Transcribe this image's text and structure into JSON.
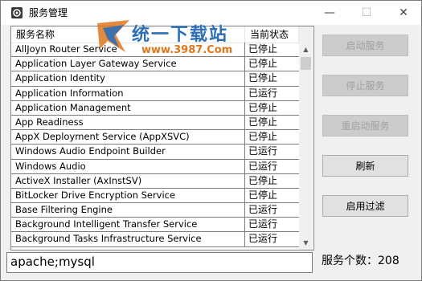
{
  "window": {
    "title": "服务管理",
    "minimize_glyph": "—",
    "maximize_glyph": "☐",
    "close_glyph": "✕"
  },
  "watermark": {
    "title": "统一下载站",
    "url": "www.3987.Com"
  },
  "list": {
    "columns": [
      "服务名称",
      "当前状态"
    ],
    "rows": [
      {
        "name": "AllJoyn Router Service",
        "status": "已停止"
      },
      {
        "name": "Application Layer Gateway Service",
        "status": "已停止"
      },
      {
        "name": "Application Identity",
        "status": "已停止"
      },
      {
        "name": "Application Information",
        "status": "已运行"
      },
      {
        "name": "Application Management",
        "status": "已停止"
      },
      {
        "name": "App Readiness",
        "status": "已停止"
      },
      {
        "name": "AppX Deployment Service (AppXSVC)",
        "status": "已停止"
      },
      {
        "name": "Windows Audio Endpoint Builder",
        "status": "已运行"
      },
      {
        "name": "Windows Audio",
        "status": "已运行"
      },
      {
        "name": "ActiveX Installer (AxInstSV)",
        "status": "已停止"
      },
      {
        "name": "BitLocker Drive Encryption Service",
        "status": "已停止"
      },
      {
        "name": "Base Filtering Engine",
        "status": "已运行"
      },
      {
        "name": "Background Intelligent Transfer Service",
        "status": "已运行"
      },
      {
        "name": "Background Tasks Infrastructure Service",
        "status": "已运行"
      }
    ]
  },
  "buttons": {
    "start": "启动服务",
    "stop": "停止服务",
    "restart": "重启动服务",
    "refresh": "刷新",
    "filter": "启用过滤"
  },
  "filter": {
    "value": "apache;mysql"
  },
  "count": {
    "text": "服务个数：208"
  }
}
